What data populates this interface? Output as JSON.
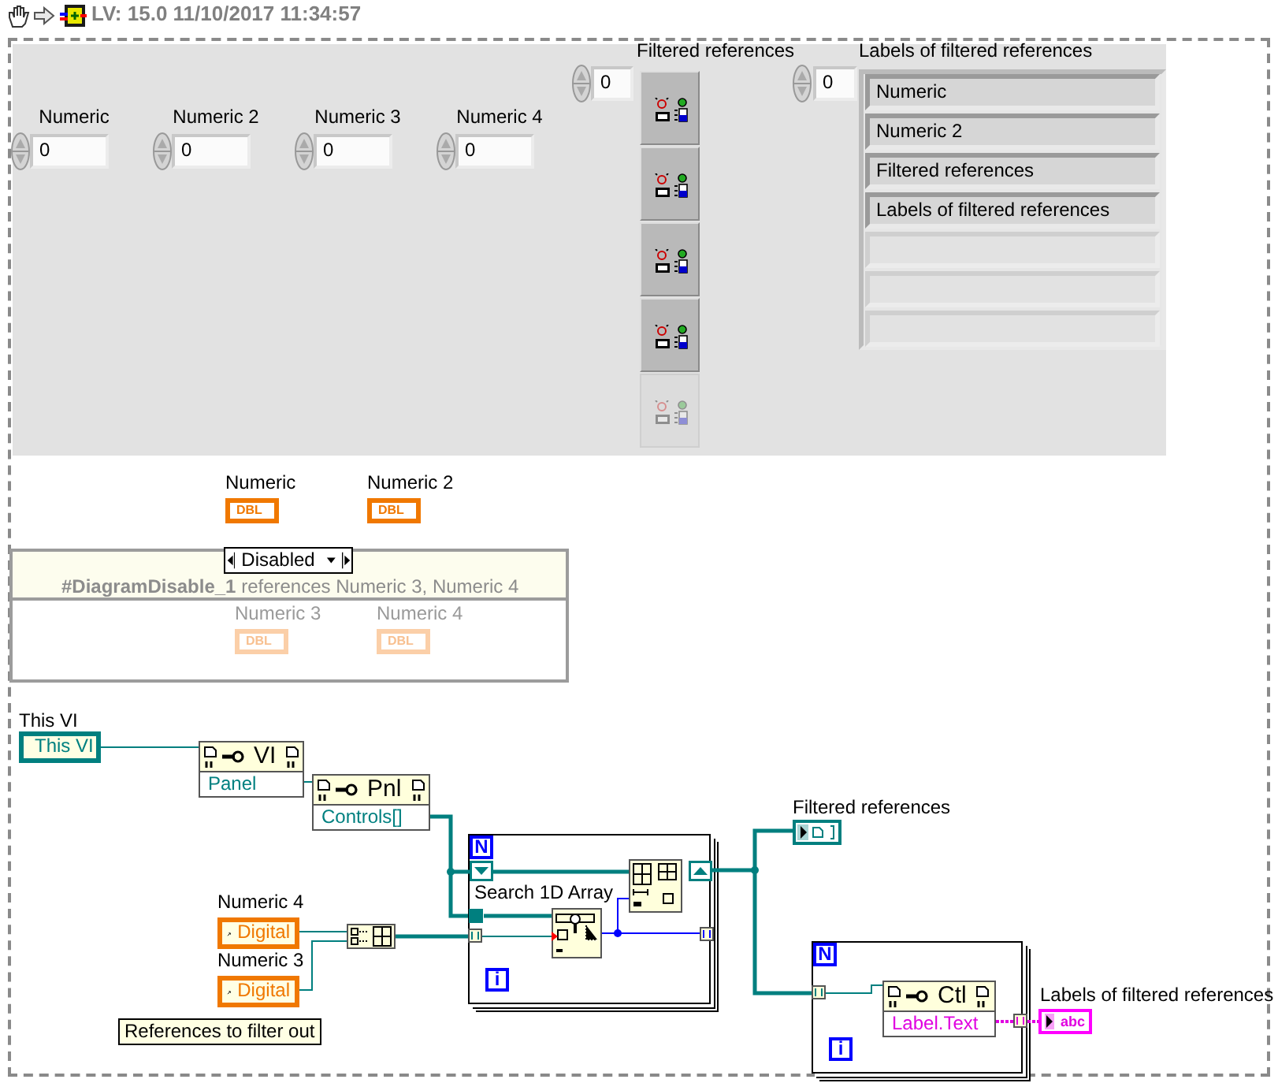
{
  "header": {
    "text": "LV: 15.0 11/10/2017 11:34:57"
  },
  "front_panel": {
    "numeric_controls": [
      {
        "label": "Numeric",
        "value": "0"
      },
      {
        "label": "Numeric 2",
        "value": "0"
      },
      {
        "label": "Numeric 3",
        "value": "0"
      },
      {
        "label": "Numeric 4",
        "value": "0"
      }
    ],
    "filtered_references": {
      "label": "Filtered references",
      "index": "0",
      "elements": [
        {
          "disabled": false
        },
        {
          "disabled": false
        },
        {
          "disabled": false
        },
        {
          "disabled": false
        },
        {
          "disabled": true
        }
      ]
    },
    "labels_of_filtered_references": {
      "label": "Labels of filtered references",
      "index": "0",
      "elements": [
        {
          "text": "Numeric",
          "disabled": false
        },
        {
          "text": "Numeric 2",
          "disabled": false
        },
        {
          "text": "Filtered references",
          "disabled": false
        },
        {
          "text": "Labels of filtered references",
          "disabled": false
        },
        {
          "disabled": true
        },
        {
          "disabled": true
        },
        {
          "disabled": true
        }
      ]
    }
  },
  "block_diagram": {
    "terminals": [
      {
        "label": "Numeric",
        "type": "DBL",
        "disabled": false
      },
      {
        "label": "Numeric 2",
        "type": "DBL",
        "disabled": false
      }
    ],
    "diagram_disable": {
      "selector": "Disabled",
      "comment": "**#DiagramDisable_1** references Numeric 3, Numeric 4",
      "terminals": [
        {
          "label": "Numeric 3",
          "type": "DBL",
          "disabled": true
        },
        {
          "label": "Numeric 4",
          "type": "DBL",
          "disabled": true
        }
      ]
    },
    "this_vi": {
      "label": "This VI",
      "text": "This VI"
    },
    "property_nodes": [
      {
        "class": "VI",
        "property": "Panel",
        "kind": "reference"
      },
      {
        "class": "Pnl",
        "property": "Controls[]",
        "kind": "reference"
      },
      {
        "class": "Ctl",
        "property": "Label.Text",
        "kind": "string"
      }
    ],
    "control_references": [
      {
        "label": "Numeric 4",
        "text": "Digital"
      },
      {
        "label": "Numeric 3",
        "text": "Digital"
      }
    ],
    "comment": "References to filter out",
    "search_label": "Search 1D Array",
    "for_loops": [
      {
        "count": "N",
        "index": "i"
      },
      {
        "count": "N",
        "index": "i"
      }
    ],
    "indicators": [
      {
        "label": "Filtered references",
        "kind": "reference"
      },
      {
        "label": "Labels of filtered references",
        "kind": "string",
        "text": "abc"
      }
    ]
  }
}
